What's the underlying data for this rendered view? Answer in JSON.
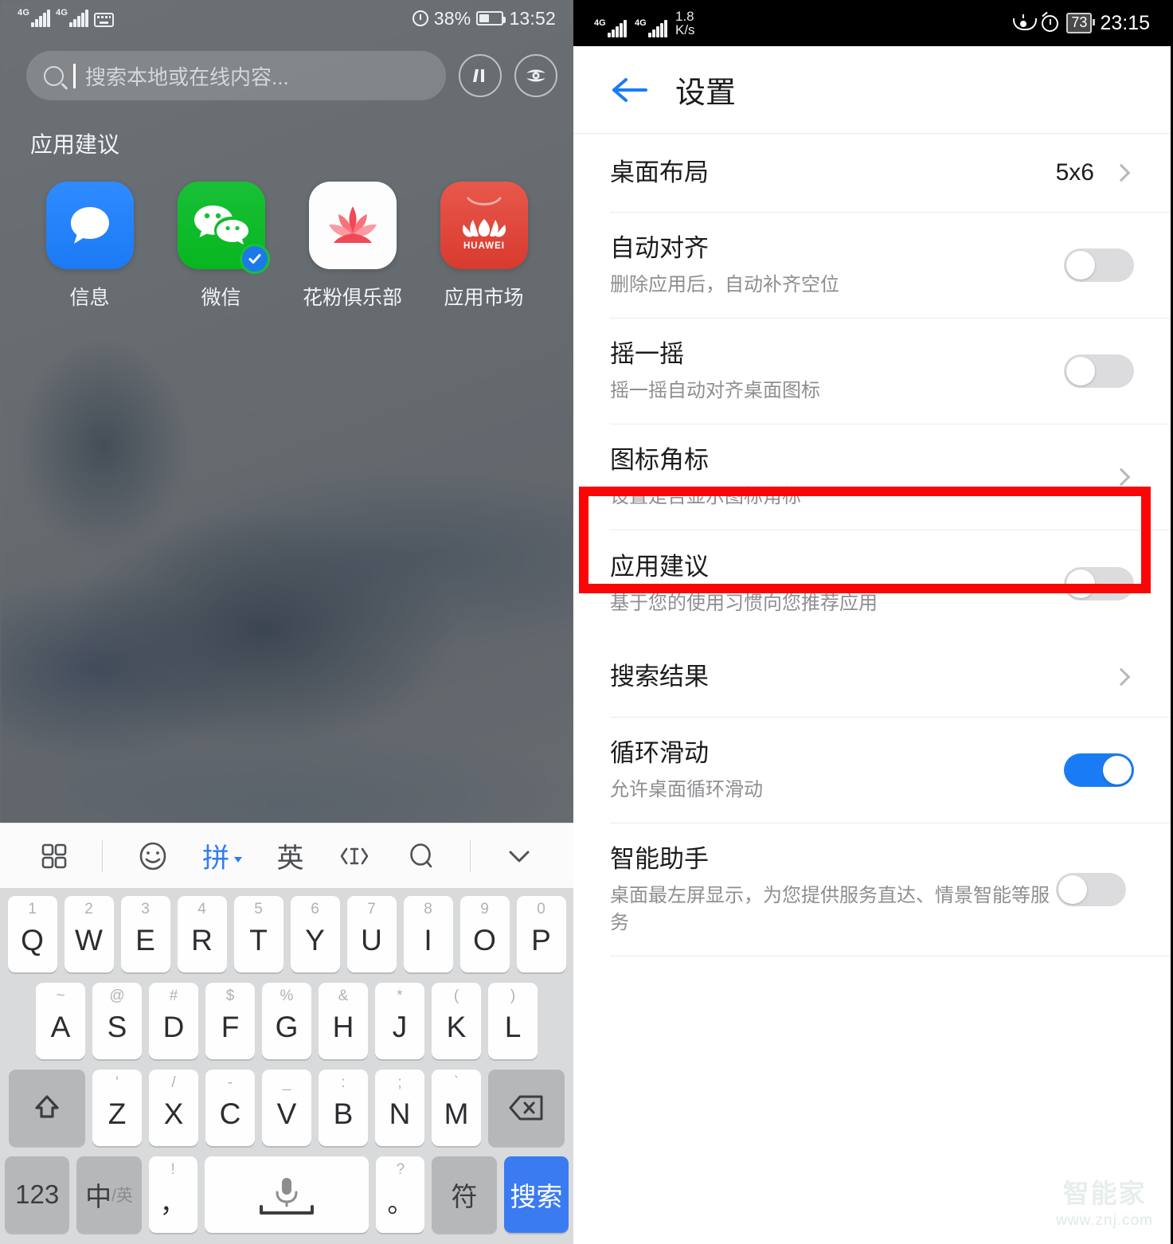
{
  "left": {
    "status_bar": {
      "network_1": "4G",
      "network_2": "4G",
      "keyboard_icon": "keyboard-icon",
      "alarm_icon": "alarm-icon",
      "battery_percent": "38%",
      "time": "13:52"
    },
    "search": {
      "placeholder": "搜索本地或在线内容...",
      "value": "",
      "icons": [
        "search-icon",
        "scan-icon",
        "lens-icon"
      ]
    },
    "section_title": "应用建议",
    "apps": [
      {
        "name": "信息",
        "icon": "messages-icon"
      },
      {
        "name": "微信",
        "icon": "wechat-icon"
      },
      {
        "name": "花粉俱乐部",
        "icon": "huafen-club-icon"
      },
      {
        "name": "应用市场",
        "icon": "app-gallery-icon",
        "brand": "HUAWEI"
      }
    ],
    "keyboard": {
      "toolbar": [
        {
          "name": "panel-grid-icon",
          "type": "icon"
        },
        {
          "name": "separator",
          "type": "sep"
        },
        {
          "name": "emoji-icon",
          "type": "icon"
        },
        {
          "name": "pinyin-mode",
          "type": "text",
          "label": "拼",
          "active": true
        },
        {
          "name": "english-mode",
          "type": "text",
          "label": "英"
        },
        {
          "name": "cursor-move-icon",
          "type": "icon"
        },
        {
          "name": "search-icon",
          "type": "icon"
        },
        {
          "name": "separator",
          "type": "sep"
        },
        {
          "name": "collapse-keyboard-icon",
          "type": "icon"
        }
      ],
      "row1": [
        {
          "alt": "1",
          "main": "Q"
        },
        {
          "alt": "2",
          "main": "W"
        },
        {
          "alt": "3",
          "main": "E"
        },
        {
          "alt": "4",
          "main": "R"
        },
        {
          "alt": "5",
          "main": "T"
        },
        {
          "alt": "6",
          "main": "Y"
        },
        {
          "alt": "7",
          "main": "U"
        },
        {
          "alt": "8",
          "main": "I"
        },
        {
          "alt": "9",
          "main": "O"
        },
        {
          "alt": "0",
          "main": "P"
        }
      ],
      "row2": [
        {
          "alt": "~",
          "main": "A"
        },
        {
          "alt": "@",
          "main": "S"
        },
        {
          "alt": "#",
          "main": "D"
        },
        {
          "alt": "$",
          "main": "F"
        },
        {
          "alt": "%",
          "main": "G"
        },
        {
          "alt": "&",
          "main": "H"
        },
        {
          "alt": "*",
          "main": "J"
        },
        {
          "alt": "(",
          "main": "K"
        },
        {
          "alt": ")",
          "main": "L"
        }
      ],
      "row3": [
        {
          "alt": "'",
          "main": "Z"
        },
        {
          "alt": "/",
          "main": "X"
        },
        {
          "alt": "-",
          "main": "C"
        },
        {
          "alt": "_",
          "main": "V"
        },
        {
          "alt": ":",
          "main": "B"
        },
        {
          "alt": ";",
          "main": "N"
        },
        {
          "alt": "`",
          "main": "M"
        }
      ],
      "shift_key": "shift-icon",
      "delete_key": "backspace-icon",
      "row4": {
        "numeric": "123",
        "lang_main": "中",
        "lang_sub": "/英",
        "comma_alt": "!",
        "comma_main": "，",
        "space_icon": "microphone-icon",
        "period_alt": "?",
        "period_main": "。",
        "symbol": "符",
        "search": "搜索"
      }
    }
  },
  "right": {
    "status_bar": {
      "network_1": "4G",
      "network_2": "4G",
      "net_speed_value": "1.8",
      "net_speed_unit": "K/s",
      "eye_comfort_icon": "eye-comfort-icon",
      "alarm_icon": "alarm-icon",
      "battery_percent": "73",
      "time": "23:15"
    },
    "header": {
      "back_icon": "back-arrow-icon",
      "title": "设置"
    },
    "items": [
      {
        "title": "桌面布局",
        "sub": "",
        "value": "5x6",
        "control": "chevron"
      },
      {
        "title": "自动对齐",
        "sub": "删除应用后，自动补齐空位",
        "value": "",
        "control": "toggle",
        "on": false
      },
      {
        "title": "摇一摇",
        "sub": "摇一摇自动对齐桌面图标",
        "value": "",
        "control": "toggle",
        "on": false
      },
      {
        "title": "图标角标",
        "sub": "设置是否显示图标角标",
        "value": "",
        "control": "chevron"
      },
      {
        "title": "应用建议",
        "sub": "基于您的使用习惯向您推荐应用",
        "value": "",
        "control": "toggle",
        "on": false,
        "highlighted": true
      },
      {
        "title": "搜索结果",
        "sub": "",
        "value": "",
        "control": "chevron"
      },
      {
        "title": "循环滑动",
        "sub": "允许桌面循环滑动",
        "value": "",
        "control": "toggle",
        "on": true
      },
      {
        "title": "智能助手",
        "sub": "桌面最左屏显示，为您提供服务直达、情景智能等服务",
        "value": "",
        "control": "toggle",
        "on": false
      }
    ],
    "highlight_color": "#fb0606",
    "accent_color": "#1a7cf5",
    "watermark": {
      "name": "智能家",
      "url": "www.znj.com"
    }
  }
}
